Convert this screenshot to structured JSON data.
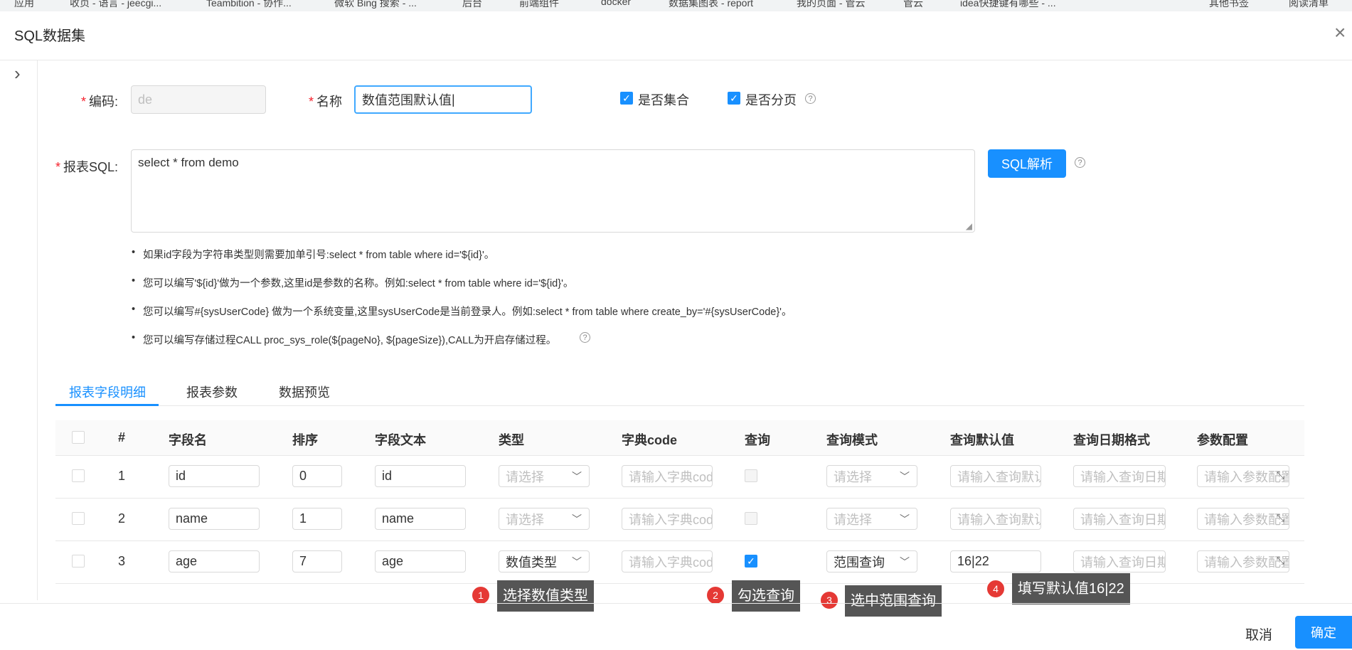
{
  "bookmarks": [
    "应用",
    "收页 - 语言 - jeecgi...",
    "Teambition - 协作...",
    "微软 Bing 搜索 - ...",
    "后台",
    "前端组件",
    "docker",
    "数据集图表 - report",
    "我的页面 - 管云",
    "管云",
    "idea快捷键有哪些 - ...",
    "其他书签",
    "阅读清单"
  ],
  "modal": {
    "title": "SQL数据集",
    "close_symbol": "×"
  },
  "form": {
    "code_label": "编码:",
    "code_value": "de",
    "name_label": "名称",
    "name_value": "数值范围默认值",
    "is_collection_label": "是否集合",
    "is_paging_label": "是否分页",
    "sql_label": "报表SQL:",
    "sql_value": "select * from demo",
    "parse_button": "SQL解析"
  },
  "tips": [
    "如果id字段为字符串类型则需要加单引号:select * from table where id='${id}'。",
    "您可以编写'${id}'做为一个参数,这里id是参数的名称。例如:select * from table where id='${id}'。",
    "您可以编写#{sysUserCode} 做为一个系统变量,这里sysUserCode是当前登录人。例如:select * from table where create_by='#{sysUserCode}'。",
    "您可以编写存储过程CALL proc_sys_role(${pageNo}, ${pageSize}),CALL为开启存储过程。"
  ],
  "tabs": [
    "报表字段明细",
    "报表参数",
    "数据预览"
  ],
  "table": {
    "headers": [
      "#",
      "字段名",
      "排序",
      "字段文本",
      "类型",
      "字典code",
      "查询",
      "查询模式",
      "查询默认值",
      "查询日期格式",
      "参数配置"
    ],
    "placeholders": {
      "type": "请选择",
      "dict": "请输入字典code",
      "mode": "请选择",
      "default": "请输入查询默认值",
      "date_format": "请输入查询日期格式",
      "param": "请输入参数配置"
    },
    "rows": [
      {
        "index": "1",
        "field": "id",
        "order": "0",
        "text": "id",
        "type": "",
        "query": false,
        "mode": "",
        "default": ""
      },
      {
        "index": "2",
        "field": "name",
        "order": "1",
        "text": "name",
        "type": "",
        "query": false,
        "mode": "",
        "default": ""
      },
      {
        "index": "3",
        "field": "age",
        "order": "7",
        "text": "age",
        "type": "数值类型",
        "query": true,
        "mode": "范围查询",
        "default": "16|22"
      }
    ]
  },
  "annotations": [
    {
      "num": "1",
      "text": "选择数值类型"
    },
    {
      "num": "2",
      "text": "勾选查询"
    },
    {
      "num": "3",
      "text": "选中范围查询"
    },
    {
      "num": "4",
      "text": "填写默认值16|22"
    }
  ],
  "footer": {
    "cancel": "取消",
    "ok": "确定"
  },
  "colors": {
    "primary": "#1890ff",
    "required": "#f5222d",
    "badge": "#e53935",
    "annotation_bg": "#555555"
  }
}
